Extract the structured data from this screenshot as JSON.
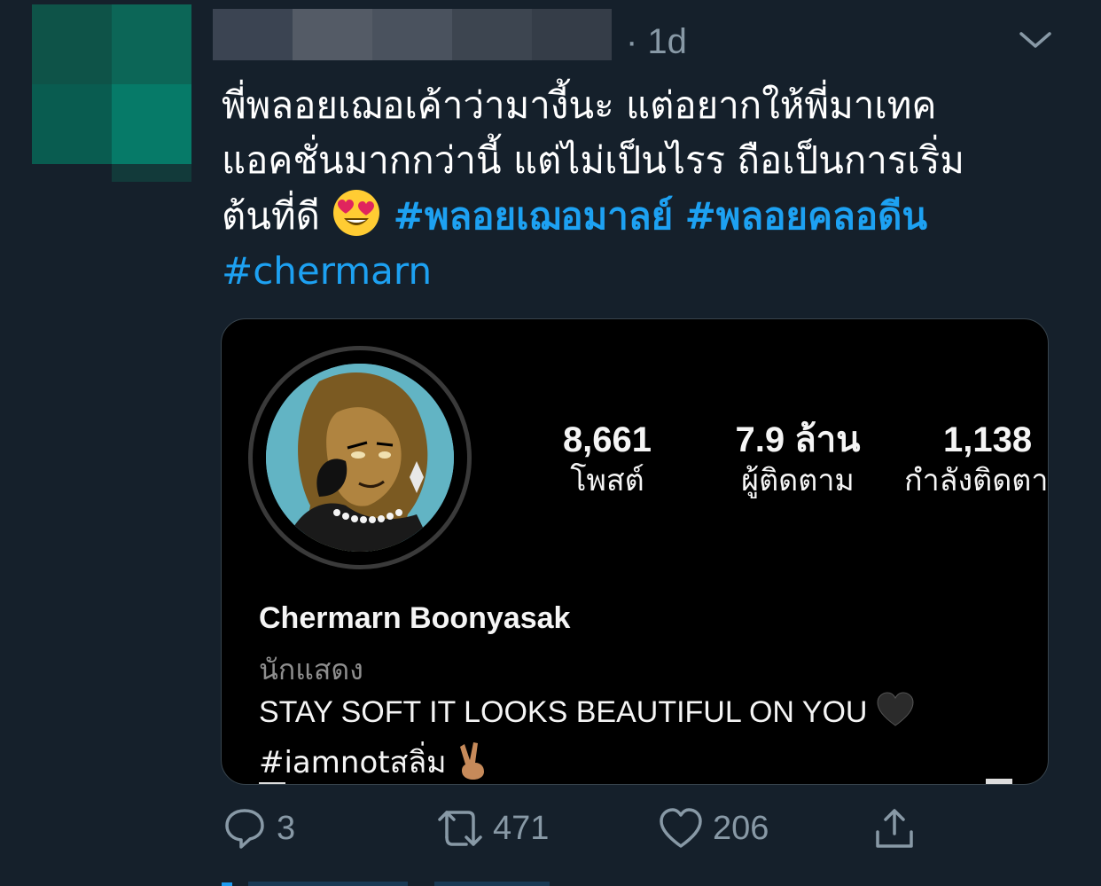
{
  "tweet": {
    "timestamp": "· 1d",
    "text_line1": "พี่พลอยเฌอเค้าว่ามางี้นะ แต่อยากให้พี่มาเทค",
    "text_line2": "แอคชั่นมากกว่านี้ แต่ไม่เป็นไรร ถือเป็นการเริ่ม",
    "text_line3_prefix": "ต้นที่ดี",
    "hashtag1": "#พลอยเฌอมาลย์",
    "hashtag2": "#พลอยคลอดีน",
    "hashtag3": "#chermarn"
  },
  "instagram": {
    "posts_count": "8,661",
    "posts_label": "โพสต์",
    "followers_count": "7.9 ล้าน",
    "followers_label": "ผู้ติดตาม",
    "following_count": "1,138",
    "following_label": "กำลังติดตา",
    "name": "Chermarn Boonyasak",
    "category": "นักแสดง",
    "bio_line1": "STAY SOFT IT LOOKS BEAUTIFUL ON YOU",
    "bio_line2": "#iamnotสลิ่ม"
  },
  "actions": {
    "replies": "3",
    "retweets": "471",
    "likes": "206"
  },
  "colors": {
    "background": "#15202b",
    "hashtag": "#1da1f2",
    "muted": "#8899a6"
  },
  "icons": [
    "chevron-down-icon",
    "reply-icon",
    "retweet-icon",
    "heart-icon",
    "share-icon",
    "heart-eyes-emoji",
    "black-heart-emoji",
    "victory-hand-emoji"
  ]
}
